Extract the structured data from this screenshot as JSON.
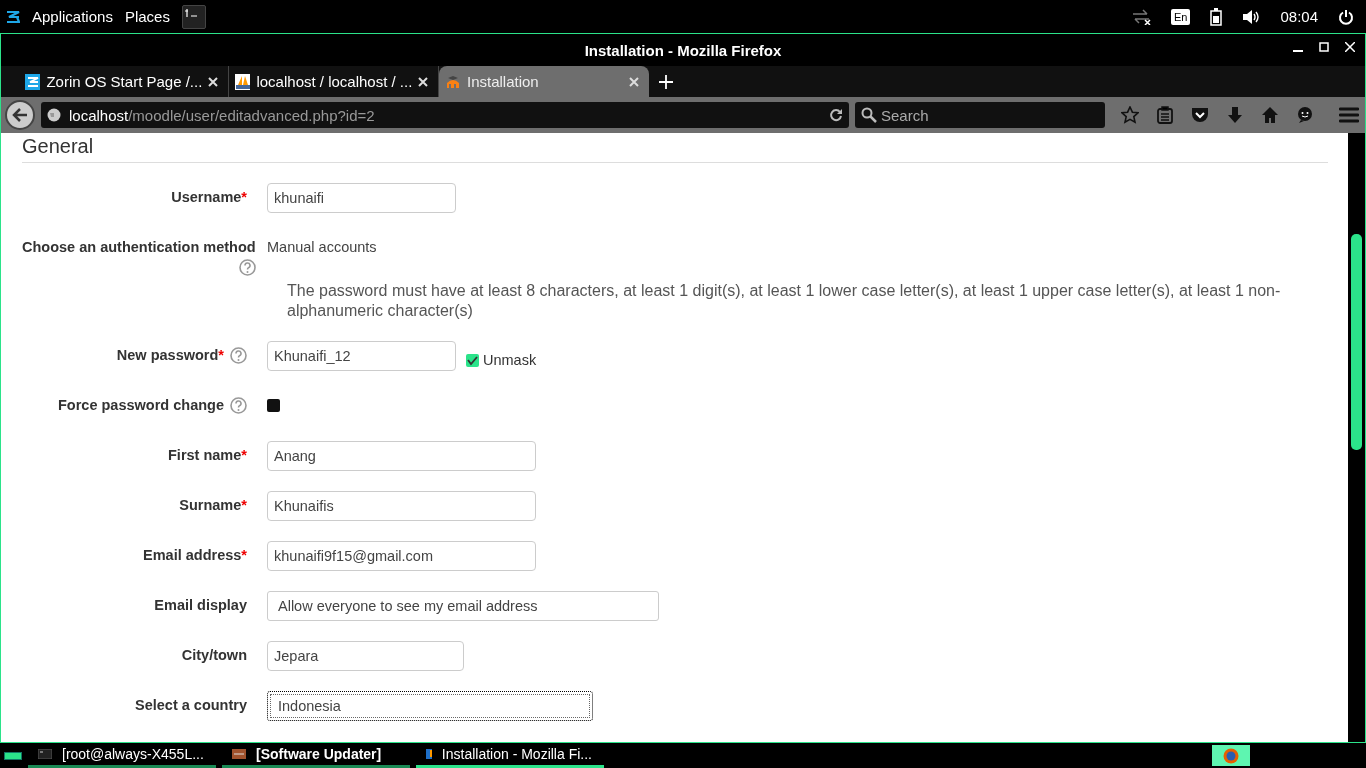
{
  "panel": {
    "menus": [
      "Applications",
      "Places"
    ],
    "keyboard": "En",
    "clock": "08:04"
  },
  "window": {
    "title": "Installation - Mozilla Firefox"
  },
  "tabs": [
    {
      "label": "Zorin OS Start Page /...",
      "selected": false
    },
    {
      "label": "localhost / localhost / ...",
      "selected": false
    },
    {
      "label": "Installation",
      "selected": true
    }
  ],
  "address": {
    "host": "localhost",
    "path": "/moodle/user/editadvanced.php?id=2"
  },
  "search": {
    "placeholder": "Search"
  },
  "form": {
    "section": "General",
    "rows": [
      {
        "kind": "short_field",
        "label": "Username",
        "required_mark": "*",
        "help": false,
        "value": "khunaifi"
      },
      {
        "kind": "static",
        "label": "Choose an authentication method",
        "help": true,
        "value": "Manual accounts"
      },
      {
        "kind": "note",
        "value": "The password must have at least 8 characters, at least 1 digit(s), at least 1 lower case letter(s), at least 1 upper case letter(s), at least 1 non-alphanumeric character(s)"
      },
      {
        "kind": "password",
        "label": "New password",
        "required_mark": "*",
        "help": true,
        "value": "Khunaifi_12",
        "unmask": {
          "label": "Unmask",
          "checked": true
        }
      },
      {
        "kind": "checkbox",
        "label": "Force password change",
        "help": true,
        "checked": false
      },
      {
        "kind": "field",
        "label": "First name",
        "required_mark": "*",
        "help": false,
        "value": "Anang"
      },
      {
        "kind": "field",
        "label": "Surname",
        "required_mark": "*",
        "help": false,
        "value": "Khunaifis"
      },
      {
        "kind": "field",
        "label": "Email address",
        "required_mark": "*",
        "help": false,
        "value": "khunaifi9f15@gmail.com"
      },
      {
        "kind": "wide_select",
        "label": "Email display",
        "help": false,
        "value": "Allow everyone to see my email address",
        "focused": false
      },
      {
        "kind": "city_field",
        "label": "City/town",
        "help": false,
        "value": "Jepara"
      },
      {
        "kind": "select",
        "label": "Select a country",
        "help": false,
        "value": "Indonesia",
        "focused": true
      }
    ]
  },
  "taskbar": [
    {
      "kind": "terminal",
      "label": "[root@always-X455L...",
      "urgent": false,
      "selected": false
    },
    {
      "kind": "updater",
      "label": "[Software Updater]",
      "urgent": true,
      "selected": false
    },
    {
      "kind": "firefox",
      "label": "Installation - Mozilla Fi...",
      "urgent": false,
      "selected": true
    }
  ]
}
